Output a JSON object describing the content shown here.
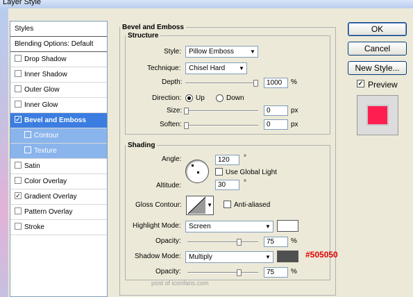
{
  "window": {
    "title": "Layer Style"
  },
  "styles_list": [
    {
      "label": "Styles",
      "kind": "head"
    },
    {
      "label": "Blending Options: Default",
      "kind": "head"
    },
    {
      "label": "Drop Shadow",
      "checked": false
    },
    {
      "label": "Inner Shadow",
      "checked": false
    },
    {
      "label": "Outer Glow",
      "checked": false
    },
    {
      "label": "Inner Glow",
      "checked": false
    },
    {
      "label": "Bevel and Emboss",
      "checked": true,
      "selected": true
    },
    {
      "label": "Contour",
      "checked": false,
      "sub": true
    },
    {
      "label": "Texture",
      "checked": false,
      "sub": true
    },
    {
      "label": "Satin",
      "checked": false
    },
    {
      "label": "Color Overlay",
      "checked": false
    },
    {
      "label": "Gradient Overlay",
      "checked": true
    },
    {
      "label": "Pattern Overlay",
      "checked": false
    },
    {
      "label": "Stroke",
      "checked": false
    }
  ],
  "bevel": {
    "title": "Bevel and Emboss",
    "structure": {
      "title": "Structure",
      "style_label": "Style:",
      "style_value": "Pillow Emboss",
      "technique_label": "Technique:",
      "technique_value": "Chisel Hard",
      "depth_label": "Depth:",
      "depth_value": "1000",
      "depth_unit": "%",
      "depth_level": 1.0,
      "direction_label": "Direction:",
      "up_label": "Up",
      "down_label": "Down",
      "size_label": "Size:",
      "size_value": "0",
      "size_unit": "px",
      "size_level": 0.0,
      "soften_label": "Soften:",
      "soften_value": "0",
      "soften_unit": "px",
      "soften_level": 0.0
    },
    "shading": {
      "title": "Shading",
      "angle_label": "Angle:",
      "angle_value": "120",
      "angle_unit": "°",
      "use_global_light": "Use Global Light",
      "altitude_label": "Altitude:",
      "altitude_value": "30",
      "altitude_unit": "°",
      "gloss_label": "Gloss Contour:",
      "anti_aliased": "Anti-aliased",
      "highlight_label": "Highlight Mode:",
      "highlight_value": "Screen",
      "highlight_color": "#ffffff",
      "hl_opacity_label": "Opacity:",
      "hl_opacity_value": "75",
      "hl_opacity_unit": "%",
      "hl_opacity_level": 0.75,
      "shadow_label": "Shadow Mode:",
      "shadow_value": "Multiply",
      "shadow_color": "#505050",
      "sh_opacity_label": "Opacity:",
      "sh_opacity_value": "75",
      "sh_opacity_unit": "%",
      "sh_opacity_level": 0.75
    }
  },
  "annotation": {
    "text": "#505050",
    "color": "#e00000"
  },
  "watermark": "post of iconfans.com",
  "buttons": {
    "ok": "OK",
    "cancel": "Cancel",
    "new_style": "New Style...",
    "preview": "Preview"
  },
  "preview_color": "#ff1e50"
}
